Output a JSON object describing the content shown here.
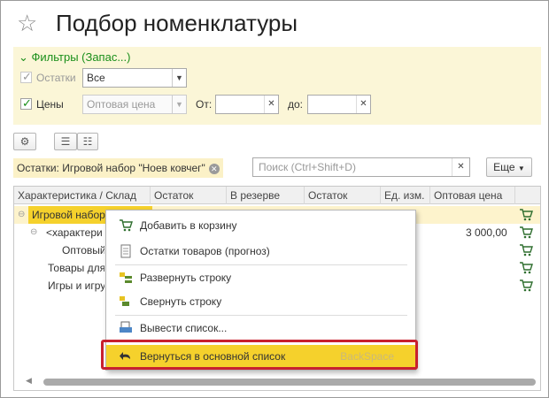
{
  "window": {
    "title": "Подбор номенклатуры"
  },
  "filters": {
    "heading": "Фильтры (Запас...)",
    "stock": {
      "label": "Остатки",
      "value": "Все",
      "checked": true
    },
    "prices": {
      "label": "Цены",
      "value": "Оптовая цена",
      "checked": true,
      "from_label": "От:",
      "to_label": "до:",
      "from_value": "",
      "to_value": ""
    }
  },
  "toolbar": {
    "more_label": "Еще"
  },
  "filter_tag": {
    "label": "Остатки: Игровой набор \"Ноев ковчег\""
  },
  "search": {
    "placeholder": "Поиск (Ctrl+Shift+D)"
  },
  "grid": {
    "columns": [
      "Характеристика / Склад",
      "Остаток",
      "В резерве",
      "Остаток",
      "Ед. изм.",
      "Оптовая цена"
    ],
    "rows": [
      {
        "name": "Игровой набор \"Н",
        "level": 0,
        "price": "",
        "selected": true
      },
      {
        "name": "<характеристи",
        "level": 1,
        "price": "3 000,00",
        "selected": false
      },
      {
        "name": "Оптовый",
        "level": 2,
        "price": "",
        "selected": false
      },
      {
        "name": "Товары для",
        "level": 1,
        "price": "",
        "selected": false
      },
      {
        "name": "Игры и игру",
        "level": 1,
        "price": "",
        "selected": false
      }
    ]
  },
  "context_menu": {
    "items": [
      {
        "label": "Добавить в корзину",
        "icon": "cart-icon"
      },
      {
        "label": "Остатки товаров (прогноз)",
        "icon": "report-icon"
      },
      {
        "label": "Развернуть строку",
        "icon": "expand-icon"
      },
      {
        "label": "Свернуть строку",
        "icon": "collapse-icon"
      },
      {
        "label": "Вывести список...",
        "icon": "print-list-icon"
      },
      {
        "label": "Вернуться в основной список",
        "icon": "back-arrow-icon",
        "shortcut": "BackSpace",
        "highlighted": true
      }
    ]
  },
  "colors": {
    "accent": "#f5d12c",
    "filters_bg": "#fbf6d7",
    "green_text": "#1a8f1a",
    "red_outline": "#c8202e"
  }
}
